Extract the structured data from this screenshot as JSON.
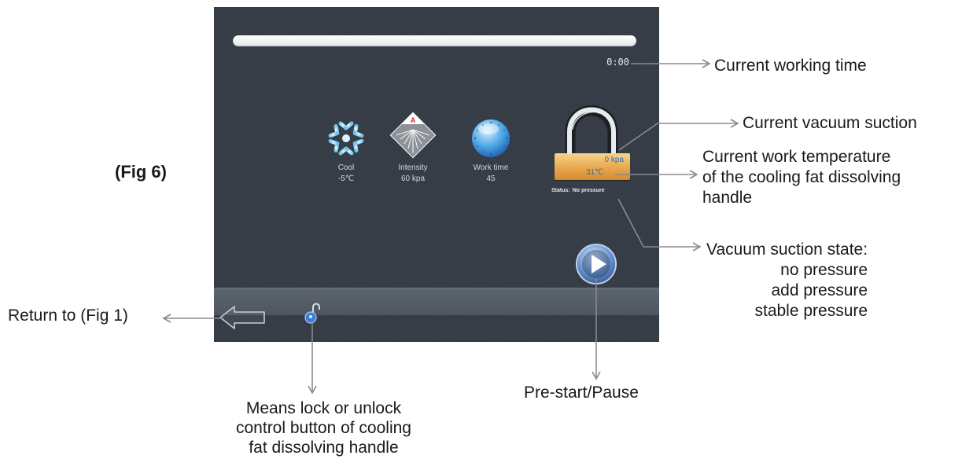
{
  "figure_label": "(Fig 6)",
  "screen": {
    "progress": 0,
    "working_time": "0:00",
    "params": [
      {
        "icon": "snowflake-icon",
        "label": "Cool",
        "value": "-5℃"
      },
      {
        "icon": "intensity-icon",
        "label": "Intensity",
        "value": "60 kpa"
      },
      {
        "icon": "clock-icon",
        "label": "Work time",
        "value": "45"
      }
    ],
    "handle": {
      "vacuum": "0 kpa",
      "temperature": "31℃",
      "status_label": "Status:",
      "status_value": "No pressure"
    },
    "bottom_bar": {
      "back_icon": "back-arrow-icon",
      "lock_icon": "unlock-icon"
    },
    "play_icon": "play-icon"
  },
  "annotations": {
    "current_time": "Current working time",
    "current_vacuum": "Current vacuum suction",
    "temperature_lines": [
      "Current work temperature",
      "of the cooling fat dissolving",
      "handle"
    ],
    "vacuum_state_title": "Vacuum suction state:",
    "vacuum_state_options": [
      "no pressure",
      "add pressure",
      "stable pressure"
    ],
    "return": "Return to (Fig 1)",
    "prestart": "Pre-start/Pause",
    "lock_lines": [
      "Means lock or unlock",
      "control button of cooling",
      "fat dissolving handle"
    ]
  },
  "colors": {
    "screen_bg": "#353c46",
    "panel": "#e7a84d",
    "panel_text": "#2f6fb2",
    "leader": "#8a8a8a"
  }
}
